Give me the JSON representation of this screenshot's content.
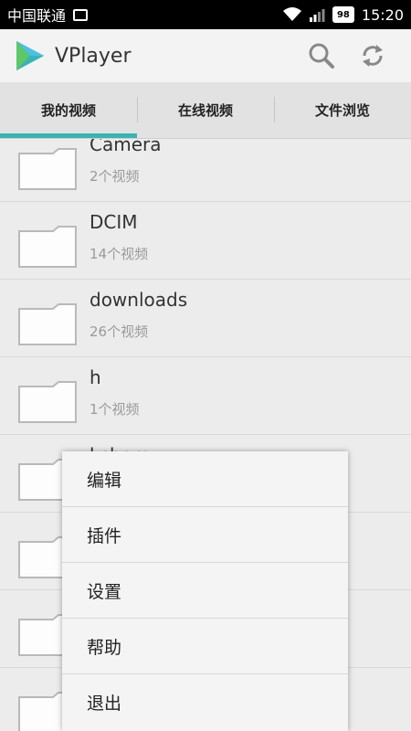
{
  "status_bar": {
    "carrier": "中国联通",
    "battery": "98",
    "time": "15:20"
  },
  "app_bar": {
    "title": "VPlayer",
    "icons": [
      "app-logo",
      "search-icon",
      "refresh-icon"
    ]
  },
  "tabs": [
    {
      "label": "我的视频",
      "active": true
    },
    {
      "label": "在线视频",
      "active": false
    },
    {
      "label": "文件浏览",
      "active": false
    }
  ],
  "folders": [
    {
      "name": "Camera",
      "count": "2个视频"
    },
    {
      "name": "DCIM",
      "count": "14个视频"
    },
    {
      "name": "downloads",
      "count": "26个视频"
    },
    {
      "name": "h",
      "count": "1个视频"
    },
    {
      "name": "kshare",
      "count": ""
    },
    {
      "name": "",
      "count": ""
    },
    {
      "name": "",
      "count": ""
    },
    {
      "name": "",
      "count": ""
    }
  ],
  "menu": {
    "items": [
      "编辑",
      "插件",
      "设置",
      "帮助",
      "退出"
    ]
  },
  "colors": {
    "accent": "#37b5b2"
  }
}
